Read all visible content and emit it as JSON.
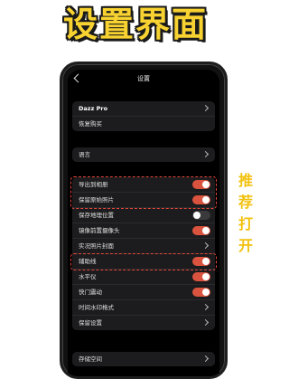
{
  "headline": "设置界面",
  "side_note": [
    "推",
    "荐",
    "打",
    "开"
  ],
  "colors": {
    "accent_toggle": "#d9533e",
    "highlight_dash": "#e0463a",
    "headline_yellow": "#f7d230"
  },
  "screen": {
    "title": "设置",
    "back_icon": "chevron-left-icon",
    "group_account": {
      "items": [
        {
          "label": "Dazz Pro",
          "control": "chevron"
        },
        {
          "label": "恢复购买",
          "control": "none"
        }
      ]
    },
    "group_language": {
      "items": [
        {
          "label": "语言",
          "control": "chevron"
        }
      ]
    },
    "group_settings": {
      "items": [
        {
          "label": "导出到相册",
          "control": "toggle",
          "on": true
        },
        {
          "label": "保留原始照片",
          "control": "toggle",
          "on": true
        },
        {
          "label": "保存地理位置",
          "control": "toggle",
          "on": false
        },
        {
          "label": "镜像前置摄像头",
          "control": "toggle",
          "on": true
        },
        {
          "label": "实况照片封面",
          "control": "chevron"
        },
        {
          "label": "辅助线",
          "control": "toggle",
          "on": true
        },
        {
          "label": "水平仪",
          "control": "toggle",
          "on": true
        },
        {
          "label": "快门震动",
          "control": "toggle",
          "on": true
        },
        {
          "label": "时间水印格式",
          "control": "chevron"
        },
        {
          "label": "保留设置",
          "control": "chevron"
        }
      ]
    },
    "group_storage": {
      "items": [
        {
          "label": "存储空间",
          "control": "chevron"
        }
      ]
    }
  }
}
